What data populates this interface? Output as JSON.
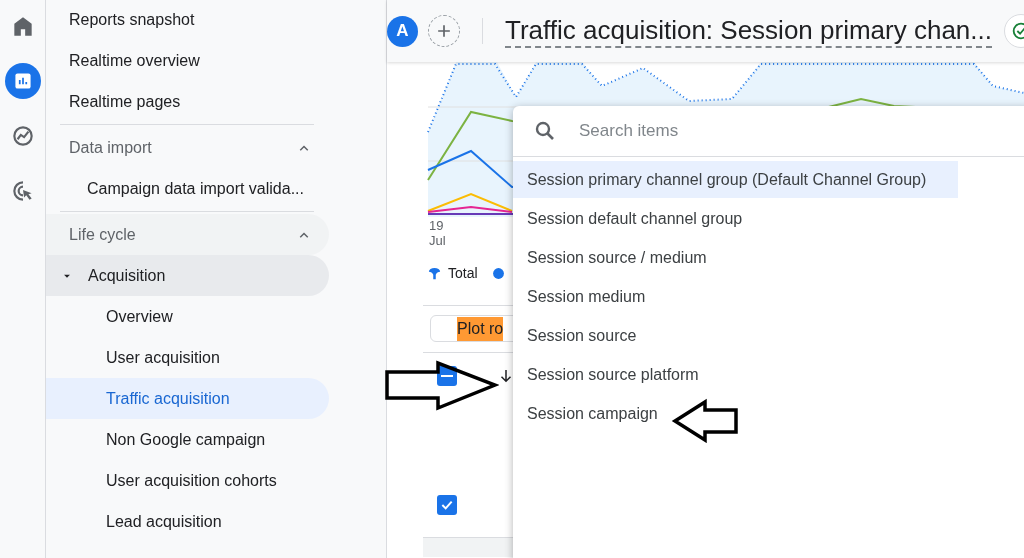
{
  "rail": [
    {
      "kind": "home",
      "selected": false
    },
    {
      "kind": "reports",
      "selected": true
    },
    {
      "kind": "explore",
      "selected": false
    },
    {
      "kind": "advertising",
      "selected": false
    }
  ],
  "sidebar": {
    "items": [
      {
        "label": "Reports snapshot",
        "selected": false
      },
      {
        "label": "Realtime overview",
        "selected": false
      },
      {
        "label": "Realtime pages",
        "selected": false
      }
    ],
    "sections": [
      {
        "label": "Data import",
        "expanded": true,
        "children": [
          {
            "label": "Campaign data import valida...",
            "selected": false
          }
        ]
      },
      {
        "label": "Life cycle",
        "expanded": true,
        "children": [
          {
            "label": "Acquisition",
            "expanded": true,
            "children": [
              {
                "label": "Overview",
                "selected": false
              },
              {
                "label": "User acquisition",
                "selected": false
              },
              {
                "label": "Traffic acquisition",
                "selected": true
              },
              {
                "label": "Non Google campaign",
                "selected": false
              },
              {
                "label": "User acquisition cohorts",
                "selected": false
              },
              {
                "label": "Lead acquisition",
                "selected": false
              }
            ]
          }
        ]
      }
    ]
  },
  "header": {
    "avatar": "A",
    "title": "Traffic acquisition: Session primary chan..."
  },
  "chart": {
    "x_day": "19",
    "x_month": "Jul",
    "legend": [
      {
        "label": "Total",
        "kind": "total",
        "color": "#1a73e8"
      },
      {
        "kind": "series",
        "color": "#1a73e8"
      }
    ]
  },
  "plot_button": {
    "label": "Plot ro",
    "highlighted": true
  },
  "table": {
    "header_indeterminate": true,
    "sorted_descending": true,
    "rows": [
      {
        "checked": true
      }
    ]
  },
  "dropdown": {
    "search": {
      "placeholder": "Search items"
    },
    "items": [
      {
        "label": "Session primary channel group (Default Channel Group)",
        "selected": true
      },
      {
        "label": "Session default channel group",
        "selected": false
      },
      {
        "label": "Session source / medium",
        "selected": false
      },
      {
        "label": "Session medium",
        "selected": false
      },
      {
        "label": "Session source",
        "selected": false
      },
      {
        "label": "Session source platform",
        "selected": false
      },
      {
        "label": "Session campaign",
        "selected": false
      }
    ]
  }
}
